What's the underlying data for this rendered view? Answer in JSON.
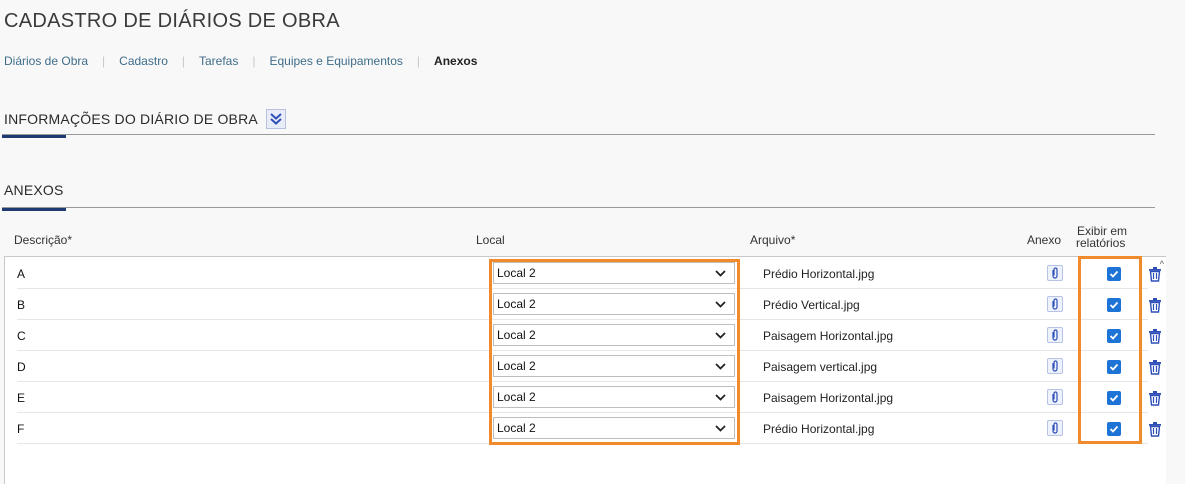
{
  "page": {
    "title": "CADASTRO DE DIÁRIOS DE OBRA"
  },
  "breadcrumb": [
    {
      "label": "Diários de Obra",
      "active": false
    },
    {
      "label": "Cadastro",
      "active": false
    },
    {
      "label": "Tarefas",
      "active": false
    },
    {
      "label": "Equipes e Equipamentos",
      "active": false
    },
    {
      "label": "Anexos",
      "active": true
    }
  ],
  "sections": {
    "info": {
      "title": "INFORMAÇÕES DO DIÁRIO DE OBRA",
      "toggle_icon": "double-chevron-down-icon"
    },
    "anexos": {
      "title": "ANEXOS"
    }
  },
  "table": {
    "headers": {
      "descricao": "Descrição*",
      "local": "Local",
      "arquivo": "Arquivo*",
      "anexo": "Anexo",
      "exibir_line1": "Exibir em",
      "exibir_line2": "relatórios"
    },
    "rows": [
      {
        "descricao": "A",
        "local": "Local 2",
        "arquivo": "Prédio Horizontal.jpg",
        "exibir": true
      },
      {
        "descricao": "B",
        "local": "Local 2",
        "arquivo": "Prédio Vertical.jpg",
        "exibir": true
      },
      {
        "descricao": "C",
        "local": "Local 2",
        "arquivo": "Paisagem Horizontal.jpg",
        "exibir": true
      },
      {
        "descricao": "D",
        "local": "Local 2",
        "arquivo": "Paisagem vertical.jpg",
        "exibir": true
      },
      {
        "descricao": "E",
        "local": "Local 2",
        "arquivo": "Paisagem Horizontal.jpg",
        "exibir": true
      },
      {
        "descricao": "F",
        "local": "Local 2",
        "arquivo": "Prédio Horizontal.jpg",
        "exibir": true
      }
    ]
  },
  "colors": {
    "accent": "#1f3a73",
    "highlight": "#f08a2b",
    "checkbox": "#1e74d6",
    "link": "#3f6d8a"
  }
}
